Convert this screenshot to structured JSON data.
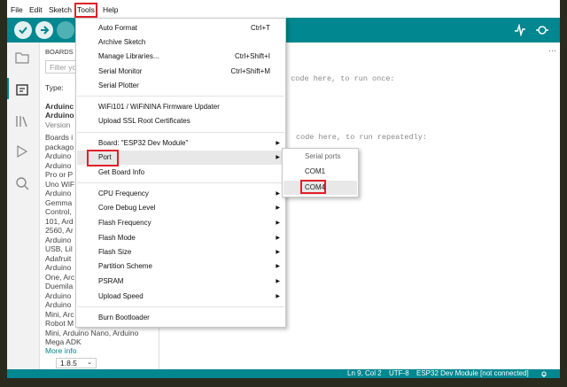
{
  "menubar": {
    "file": "File",
    "edit": "Edit",
    "sketch": "Sketch",
    "tools": "Tools",
    "help": "Help"
  },
  "sidebar": {
    "header": "BOARDS",
    "filter_placeholder": "Filter yo",
    "type_label": "Type:",
    "board_title_1": "Arduinc",
    "board_title_2": "Arduino",
    "version_label": "Version",
    "desc_lines": [
      "Boards i",
      "packago",
      "Arduino",
      "Arduino",
      "Pro or P",
      "Uno WiF",
      "Arduino",
      "Gemma",
      "Control,",
      "101, Ard",
      "2560, Ar",
      "Arduino",
      "USB, Lil",
      "Adafruit",
      "Arduino",
      "One, Arc",
      "Duemila",
      "Arduino",
      "Arduino",
      "Mini, Arc",
      "Robot M",
      "Mini, Arduino Nano, Arduino",
      "Mega ADK"
    ],
    "more_info": "More info",
    "version_value": "1.8.5"
  },
  "editor": {
    "line1": "p code here, to run once:",
    "line2": "code here, to run repeatedly:"
  },
  "tools_menu": {
    "items": [
      {
        "label": "Auto Format",
        "shortcut": "Ctrl+T"
      },
      {
        "label": "Archive Sketch",
        "shortcut": ""
      },
      {
        "label": "Manage Libraries...",
        "shortcut": "Ctrl+Shift+I"
      },
      {
        "label": "Serial Monitor",
        "shortcut": "Ctrl+Shift+M"
      },
      {
        "label": "Serial Plotter",
        "shortcut": ""
      },
      {
        "label": "WiFi101 / WiFiNINA Firmware Updater",
        "shortcut": ""
      },
      {
        "label": "Upload SSL Root Certificates",
        "shortcut": ""
      },
      {
        "label": "Board: \"ESP32 Dev Module\"",
        "shortcut": ""
      },
      {
        "label": "Port",
        "shortcut": ""
      },
      {
        "label": "Get Board Info",
        "shortcut": ""
      },
      {
        "label": "CPU Frequency",
        "shortcut": ""
      },
      {
        "label": "Core Debug Level",
        "shortcut": ""
      },
      {
        "label": "Flash Frequency",
        "shortcut": ""
      },
      {
        "label": "Flash Mode",
        "shortcut": ""
      },
      {
        "label": "Flash Size",
        "shortcut": ""
      },
      {
        "label": "Partition Scheme",
        "shortcut": ""
      },
      {
        "label": "PSRAM",
        "shortcut": ""
      },
      {
        "label": "Upload Speed",
        "shortcut": ""
      },
      {
        "label": "Burn Bootloader",
        "shortcut": ""
      }
    ],
    "arrow": "▶"
  },
  "port_menu": {
    "header": "Serial ports",
    "com1": "COM1",
    "com4": "COM4"
  },
  "status": {
    "position": "Ln 9, Col 2",
    "encoding": "UTF-8",
    "board": "ESP32 Dev Module [not connected]"
  },
  "toolbar": {
    "more": "···"
  },
  "colors": {
    "accent": "#00878f",
    "highlight_box": "#e0202a"
  }
}
